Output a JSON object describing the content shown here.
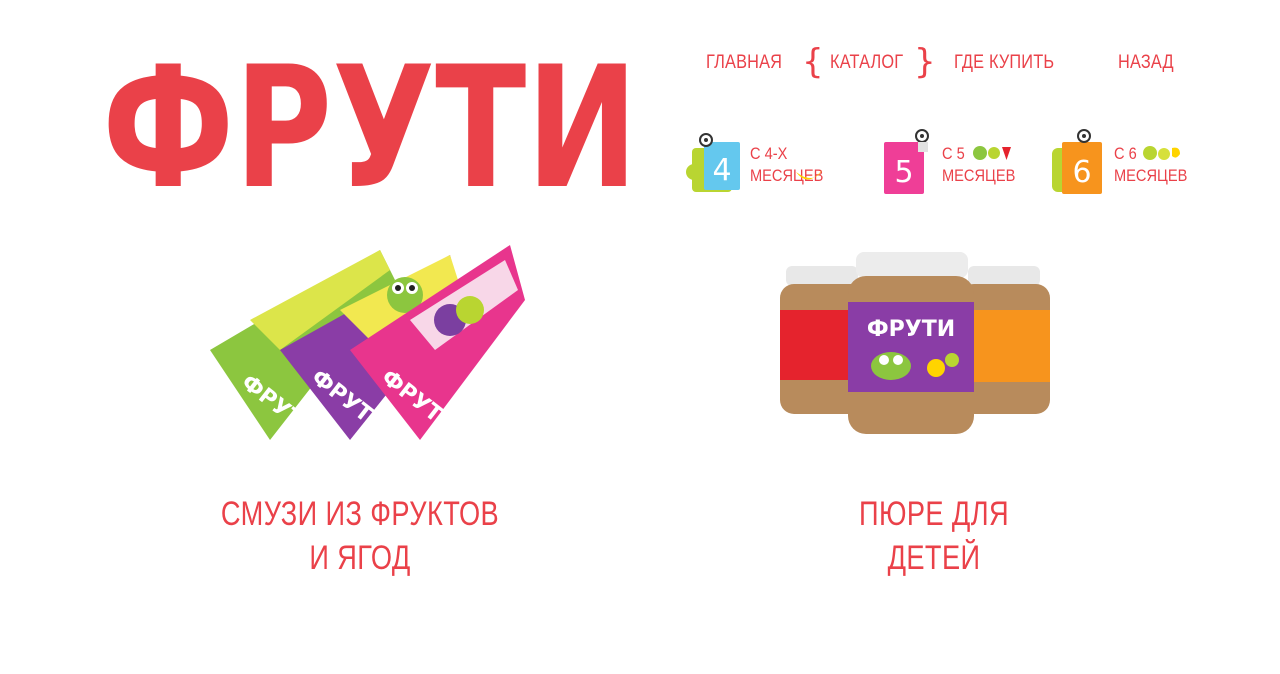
{
  "brand": {
    "logo_text": "ФРУТИ",
    "color": "#ea4149"
  },
  "nav": {
    "home": "ГЛАВНАЯ",
    "catalog": "КАТАЛОГ",
    "where_to_buy": "ГДЕ КУПИТЬ",
    "back": "НАЗАД"
  },
  "age_groups": [
    {
      "number": "4",
      "line1": "С 4-Х",
      "line2": "МЕСЯЦЕВ",
      "color": "#64c8ee"
    },
    {
      "number": "5",
      "line1": "С 5",
      "line2": "МЕСЯЦЕВ",
      "color": "#ef3e97"
    },
    {
      "number": "6",
      "line1": "С 6",
      "line2": "МЕСЯЦЕВ",
      "color": "#f7941d"
    }
  ],
  "products": [
    {
      "line1": "СМУЗИ ИЗ ФРУКТОВ",
      "line2": "И ЯГОД",
      "pack_label": "ФРУТИ"
    },
    {
      "line1": "ПЮРЕ ДЛЯ",
      "line2": "ДЕТЕЙ",
      "jar_label": "ФРУТИ"
    }
  ]
}
